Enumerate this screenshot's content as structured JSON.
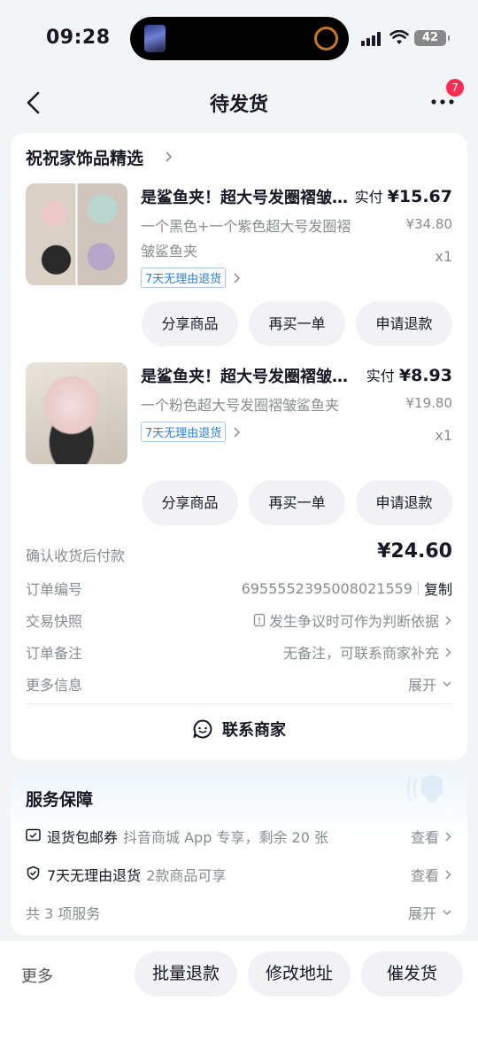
{
  "status_bar": {
    "time": "09:28",
    "battery": "42"
  },
  "nav": {
    "title": "待发货",
    "badge": "7"
  },
  "shop": {
    "name": "祝祝家饰品精选"
  },
  "products": [
    {
      "title": "是鲨鱼夹！超大号发圈褶皱鲨鱼夹",
      "spec": "一个黑色+一个紫色超大号发圈褶皱鲨鱼夹",
      "tag": "7天无理由退货",
      "price_label": "实付",
      "price": "¥15.67",
      "orig_price": "¥34.80",
      "qty": "x1",
      "buttons": [
        "分享商品",
        "再买一单",
        "申请退款"
      ]
    },
    {
      "title": "是鲨鱼夹！超大号发圈褶皱鲨鱼夹",
      "spec": "一个粉色超大号发圈褶皱鲨鱼夹",
      "tag": "7天无理由退货",
      "price_label": "实付",
      "price": "¥8.93",
      "orig_price": "¥19.80",
      "qty": "x1",
      "buttons": [
        "分享商品",
        "再买一单",
        "申请退款"
      ]
    }
  ],
  "info": {
    "payment_label": "确认收货后付款",
    "total": "¥24.60",
    "order_no_label": "订单编号",
    "order_no": "6955552395008021559",
    "copy": "复制",
    "snapshot_label": "交易快照",
    "snapshot_value": "发生争议时可作为判断依据",
    "note_label": "订单备注",
    "note_value": "无备注，可联系商家补充",
    "more_label": "更多信息",
    "expand": "展开"
  },
  "contact": "联系商家",
  "service": {
    "title": "服务保障",
    "items": [
      {
        "name": "退货包邮券",
        "desc": "抖音商城 App 专享，剩余 20 张",
        "action": "查看"
      },
      {
        "name": "7天无理由退货",
        "desc": "2款商品可享",
        "action": "查看"
      }
    ],
    "summary": "共 3 项服务",
    "expand": "展开"
  },
  "bottom": {
    "more": "更多",
    "buttons": [
      "批量退款",
      "修改地址",
      "催发货"
    ]
  },
  "colors": {
    "accent": "#fe2c55",
    "tag_blue": "#2b80d6"
  }
}
